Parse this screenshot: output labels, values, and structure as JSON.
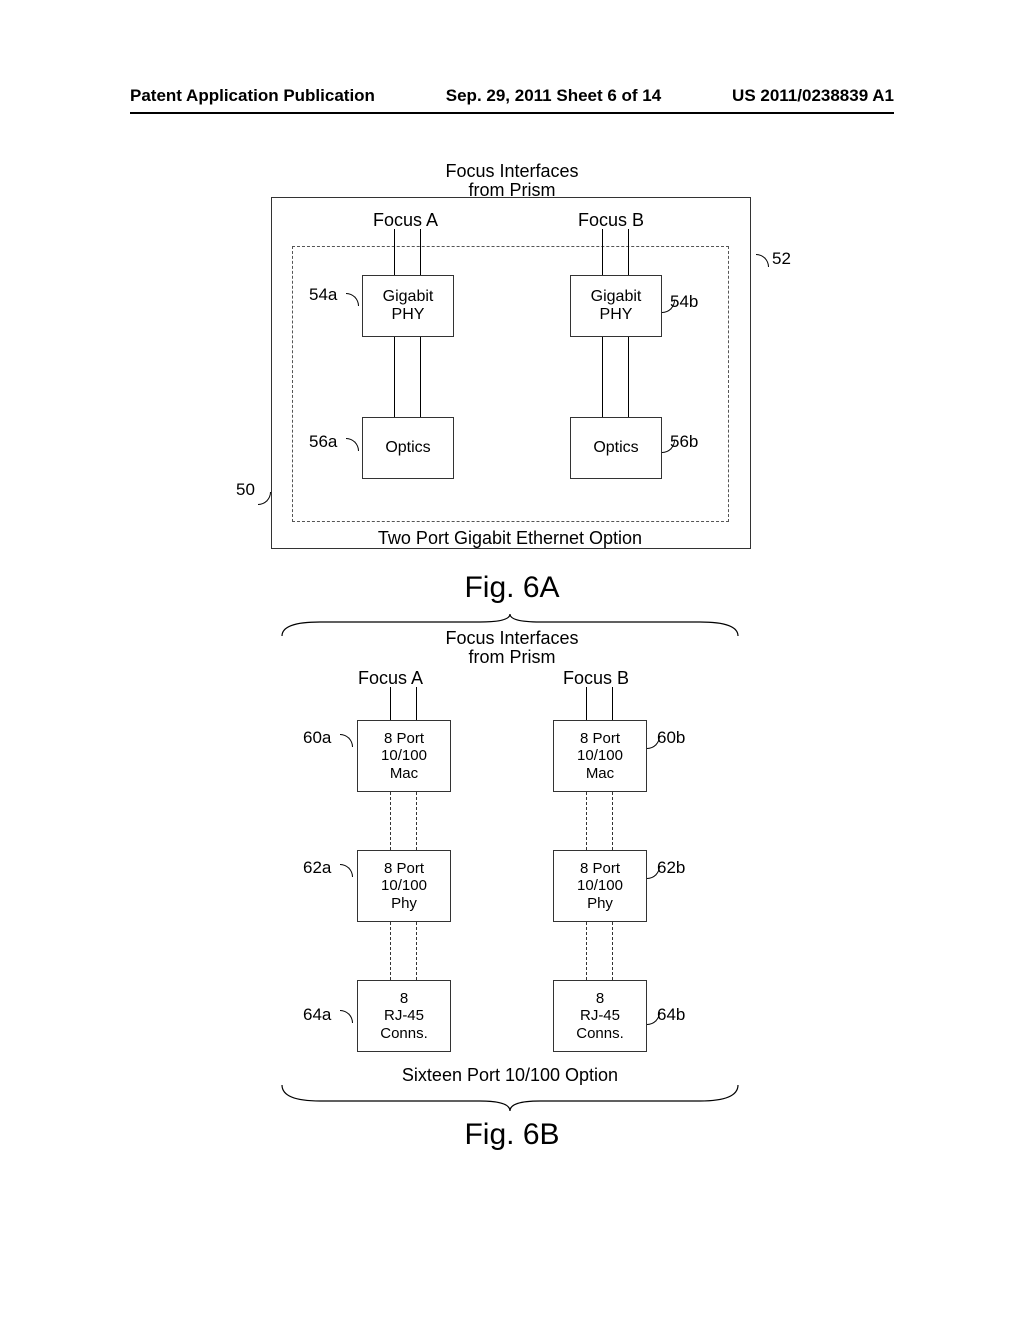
{
  "header": {
    "left": "Patent Application Publication",
    "center": "Sep. 29, 2011  Sheet 6 of 14",
    "right": "US 2011/0238839 A1"
  },
  "fig6a": {
    "title_line1": "Focus Interfaces",
    "title_line2": "from Prism",
    "focus_a": "Focus A",
    "focus_b": "Focus B",
    "phy_text": "Gigabit\nPHY",
    "optics_text": "Optics",
    "ref": {
      "r50": "50",
      "r52": "52",
      "r54a": "54a",
      "r54b": "54b",
      "r56a": "56a",
      "r56b": "56b"
    },
    "inner_caption": "Two Port Gigabit Ethernet Option",
    "label": "Fig. 6A"
  },
  "fig6b": {
    "title_line1": "Focus Interfaces",
    "title_line2": "from Prism",
    "focus_a": "Focus A",
    "focus_b": "Focus B",
    "mac_text": "8 Port\n10/100\nMac",
    "phy_text": "8 Port\n10/100\nPhy",
    "rj_text": "8\nRJ-45\nConns.",
    "ref": {
      "r60a": "60a",
      "r60b": "60b",
      "r62a": "62a",
      "r62b": "62b",
      "r64a": "64a",
      "r64b": "64b"
    },
    "caption": "Sixteen Port 10/100 Option",
    "label": "Fig. 6B"
  }
}
